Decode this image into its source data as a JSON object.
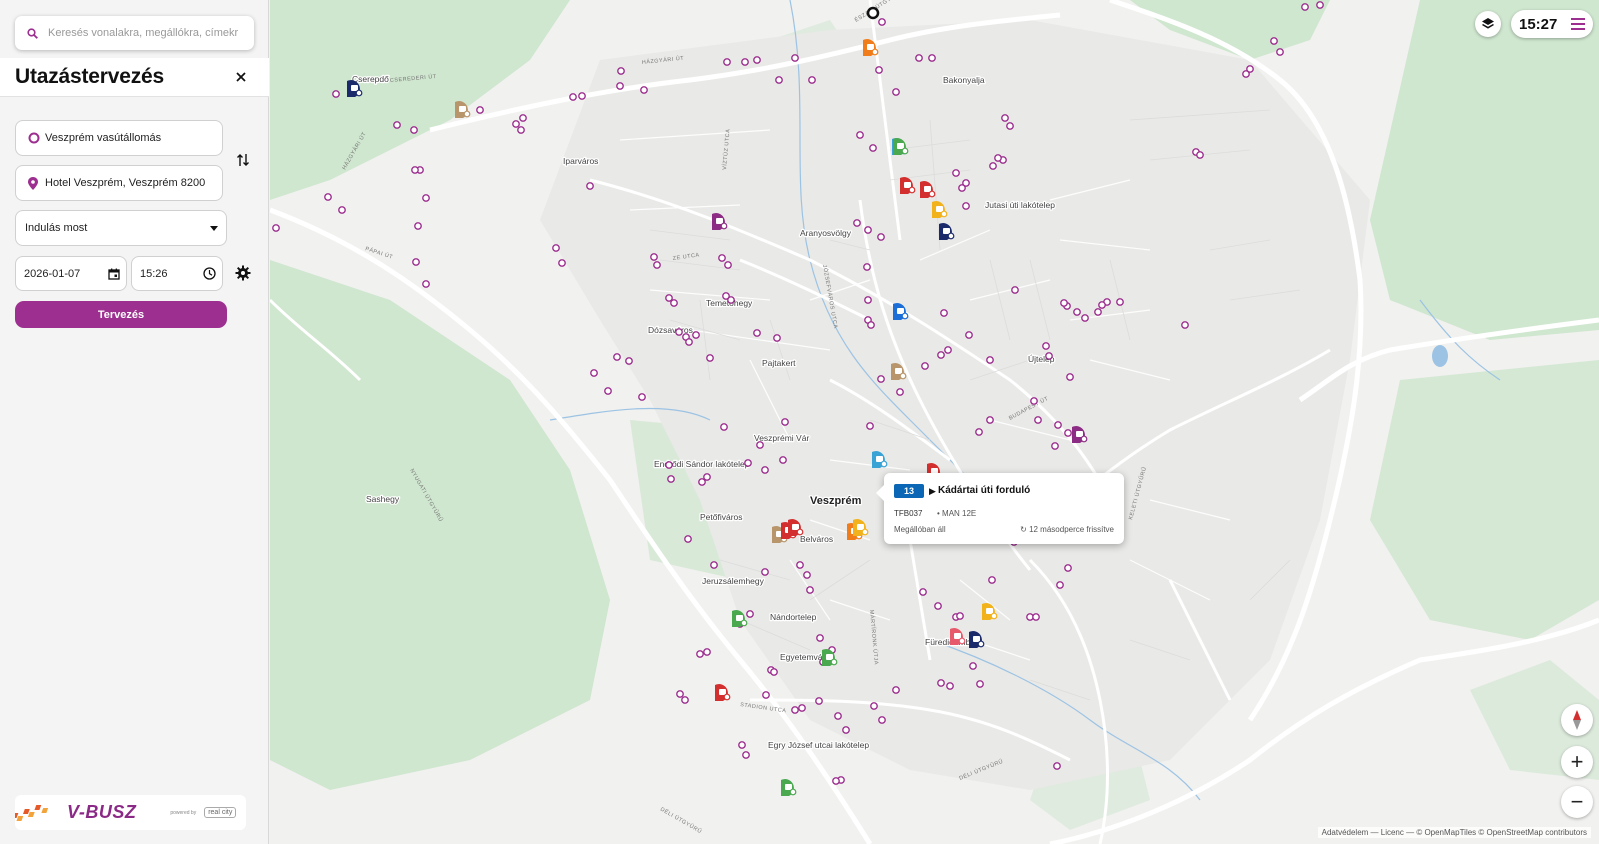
{
  "search": {
    "placeholder": "Keresés vonalakra, megállókra, címekre"
  },
  "planner": {
    "title": "Utazástervezés",
    "from": "Veszprém vasútállomás",
    "to": "Hotel Veszprém, Veszprém 8200",
    "departure_mode": "Indulás most",
    "date": "2026-01-07",
    "time": "15:26",
    "plan_button": "Tervezés"
  },
  "branding": {
    "logo": "V-BUSZ",
    "powered_by": "powered by",
    "partner": "real city"
  },
  "clock": "15:27",
  "map": {
    "place_labels": [
      "Cserepdő",
      "Bakonyalja",
      "Iparváros",
      "Aranyosvölgy",
      "Jutasi úti lakótelep",
      "Temetőhegy",
      "Dózsaváros",
      "Pajtakert",
      "Újtelep",
      "Veszprémi Vár",
      "Endrődi Sándor lakótelep",
      "Sashegy",
      "Veszprém",
      "Petőfiváros",
      "Belváros",
      "Jeruzsálemhegy",
      "Nándortelep",
      "Egyetemváros",
      "Füredidomb",
      "Egry József utcai lakótelep"
    ],
    "attribution": "Adatvédelem — Licenc — © OpenMapTiles © OpenStreetMap contributors"
  },
  "popup": {
    "route": "13",
    "stop": "Kádártai úti forduló",
    "vehicle_id": "TFB037",
    "vehicle_model": "• MAN 12E",
    "status": "Megállóban áll",
    "refresh": "12 másodperce frissítve"
  },
  "icons": [
    "search-icon",
    "close-icon",
    "swap-icon",
    "pin-icon",
    "chevron-down-icon",
    "calendar-icon",
    "clock-icon",
    "gear-icon",
    "layers-icon",
    "menu-icon",
    "compass-icon",
    "plus-icon",
    "minus-icon",
    "refresh-icon"
  ],
  "colors": {
    "accent": "#9c2f8f",
    "route_badge": "#0b67b5"
  }
}
